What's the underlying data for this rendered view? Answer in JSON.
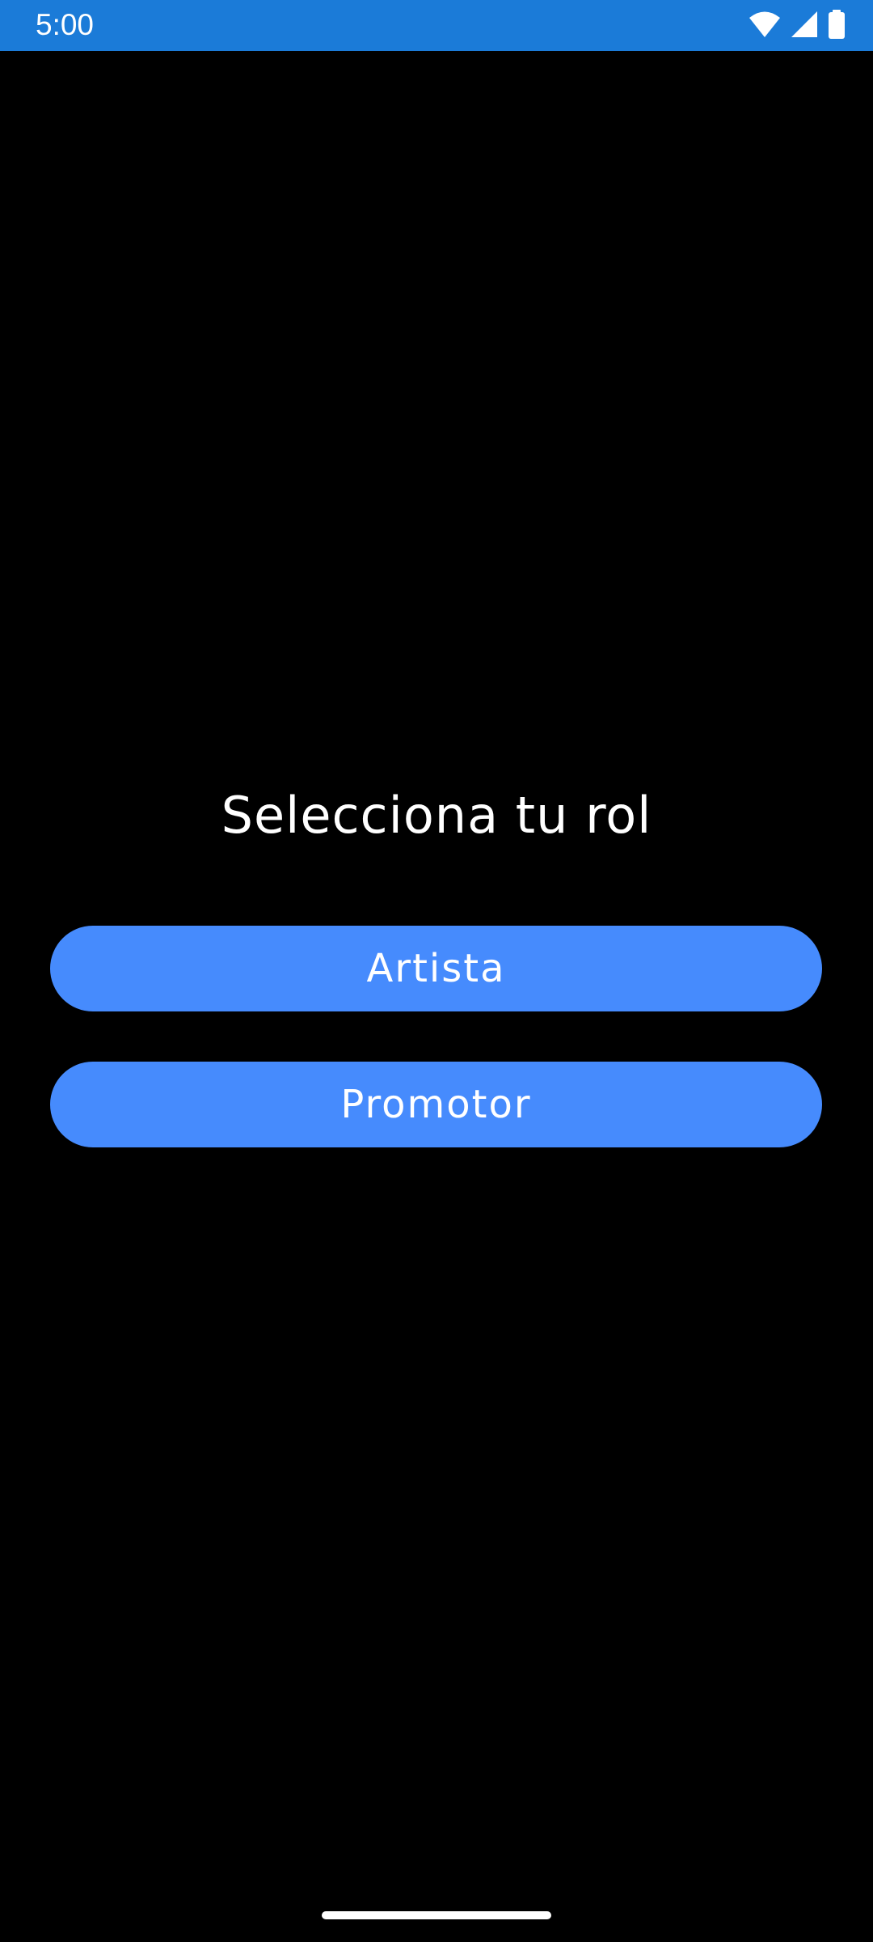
{
  "status_bar": {
    "time": "5:00",
    "color": "#1B7BD8",
    "icons": [
      "wifi-icon",
      "cell-signal-icon",
      "battery-icon"
    ]
  },
  "main": {
    "title": "Selecciona tu rol",
    "buttons": [
      {
        "label": "Artista"
      },
      {
        "label": "Promotor"
      }
    ],
    "button_color": "#468BFD",
    "background": "#000000"
  }
}
